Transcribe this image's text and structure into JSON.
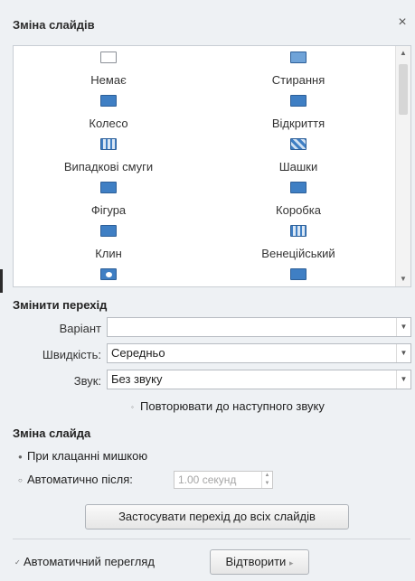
{
  "panel": {
    "title": "Зміна слайдів",
    "close_glyph": "×"
  },
  "transitions": [
    {
      "label": "Немає",
      "icon": "empty-slide-icon"
    },
    {
      "label": "Стирання",
      "icon": "wipe-icon"
    },
    {
      "label": "Колесо",
      "icon": "wheel-icon"
    },
    {
      "label": "Відкриття",
      "icon": "uncover-icon"
    },
    {
      "label": "Випадкові смуги",
      "icon": "random-bars-icon"
    },
    {
      "label": "Шашки",
      "icon": "checkerboard-icon"
    },
    {
      "label": "Фігура",
      "icon": "shape-icon"
    },
    {
      "label": "Коробка",
      "icon": "box-icon"
    },
    {
      "label": "Клин",
      "icon": "wedge-icon"
    },
    {
      "label": "Венеційський",
      "icon": "venetian-icon"
    },
    {
      "label": "",
      "icon": "oval-icon"
    },
    {
      "label": "",
      "icon": "blue-block-icon"
    }
  ],
  "modify": {
    "heading": "Змінити перехід",
    "variant_label": "Варіант",
    "variant_value": "",
    "speed_label": "Швидкість:",
    "speed_value": "Середньо",
    "sound_label": "Звук:",
    "sound_value": "Без звуку",
    "loop_label": "Повторювати до наступного звуку"
  },
  "advance": {
    "heading": "Зміна слайда",
    "on_click_label": "При клацанні мишкою",
    "auto_label": "Автоматично після:",
    "auto_value": "1.00 секунд",
    "apply_all_label": "Застосувати перехід до всіх слайдів"
  },
  "footer": {
    "autopreview_label": "Автоматичний перегляд",
    "play_label": "Відтворити"
  },
  "colors": {
    "panel_bg": "#eef1f4",
    "accent": "#3f7fc4"
  }
}
